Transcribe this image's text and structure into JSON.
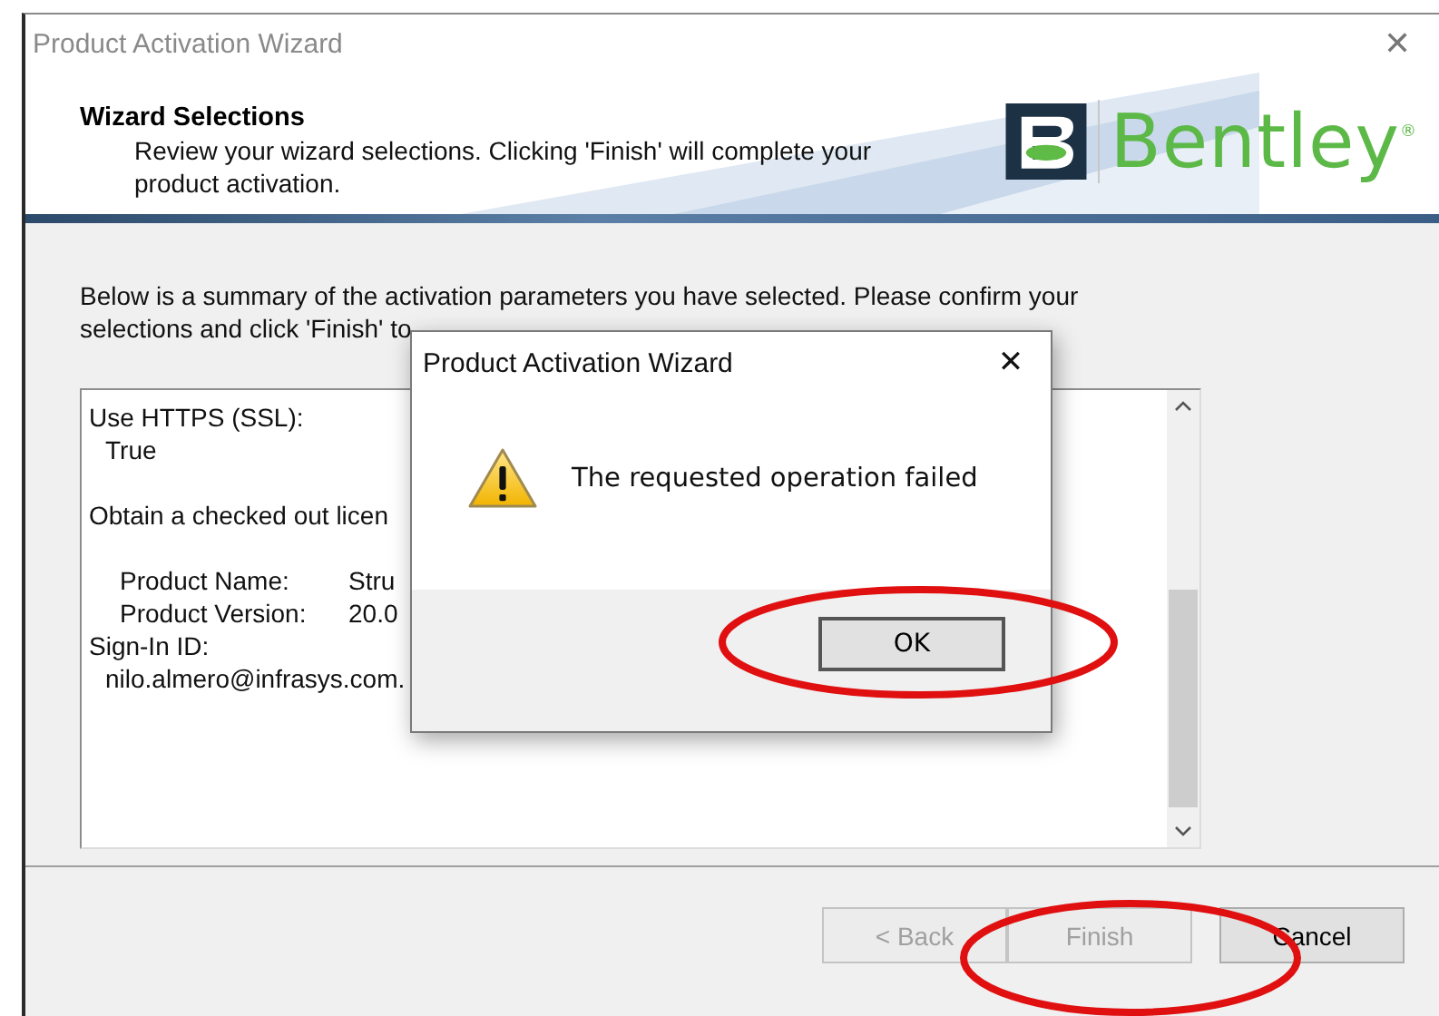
{
  "window": {
    "title": "Product Activation Wizard",
    "close": "✕"
  },
  "header": {
    "title": "Wizard Selections",
    "subtitle": "Review your wizard selections. Clicking 'Finish' will complete your product activation.",
    "logo_text": "Bentley",
    "logo_mark": "®"
  },
  "intro": "Below is a summary of the activation parameters you have selected. Please confirm your selections and click 'Finish' to",
  "summary": [
    {
      "kind": "text",
      "label": "Use HTTPS (SSL):",
      "children": [
        {
          "text": "True"
        }
      ]
    },
    {
      "kind": "fields",
      "label": "Obtain a checked out licen",
      "children": [
        {
          "label": "Product Name:",
          "value": "Stru"
        },
        {
          "label": "Product Version:",
          "value": "20.0"
        }
      ]
    },
    {
      "kind": "text",
      "label": "Sign-In ID:",
      "children": [
        {
          "text": "nilo.almero@infrasys.com."
        }
      ]
    }
  ],
  "buttons": [
    {
      "label": "< Back",
      "disabled": true
    },
    {
      "label": "Finish",
      "disabled": true
    },
    {
      "label": "Cancel",
      "disabled": false
    }
  ],
  "dialog": {
    "title": "Product Activation Wizard",
    "close": "✕",
    "message": "The requested operation failed",
    "button": "OK"
  }
}
